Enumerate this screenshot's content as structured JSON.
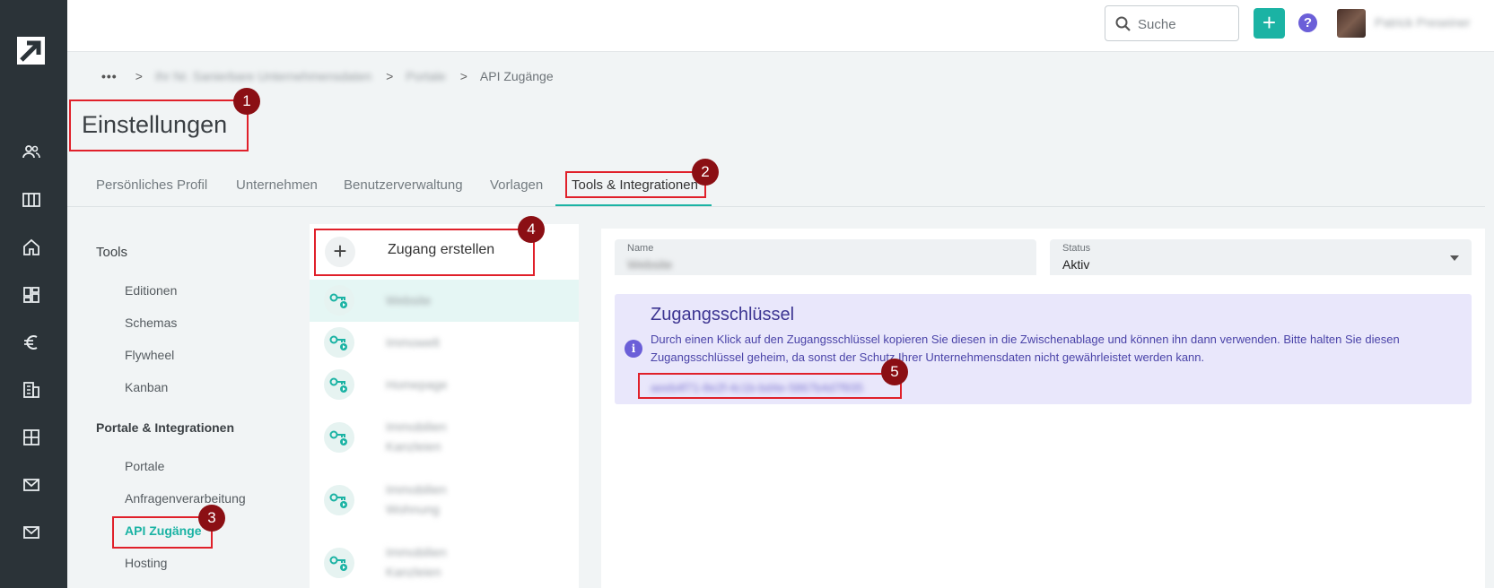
{
  "topbar": {
    "search_placeholder": "Suche",
    "add_label": "+",
    "help_label": "?",
    "user_name": "Patrick Preseiner"
  },
  "breadcrumb": {
    "dots": "•••",
    "sep": ">",
    "level1": "Ihr Nr. Sanierbare Unternehmensdaten",
    "level2": "Portale",
    "current": "API Zugänge"
  },
  "page": {
    "title": "Einstellungen"
  },
  "tabs": [
    {
      "label": "Persönliches Profil"
    },
    {
      "label": "Unternehmen"
    },
    {
      "label": "Benutzerverwaltung"
    },
    {
      "label": "Vorlagen"
    },
    {
      "label": "Tools & Integrationen",
      "active": true
    }
  ],
  "subnav": {
    "group1": "Tools",
    "items1": [
      "Editionen",
      "Schemas",
      "Flywheel",
      "Kanban"
    ],
    "group2": "Portale & Integrationen",
    "items2": [
      "Portale",
      "Anfragenverarbeitung",
      "API Zugänge",
      "Hosting"
    ]
  },
  "list": {
    "create_label": "Zugang erstellen",
    "items": [
      {
        "line1": "Website"
      },
      {
        "line1": "Immowelt"
      },
      {
        "line1": "Homepage"
      },
      {
        "line1": "Immobilien",
        "line2": "Kanzleien"
      },
      {
        "line1": "Immobilien",
        "line2": "Wohnung"
      },
      {
        "line1": "Immobilien",
        "line2": "Kanzleien"
      }
    ]
  },
  "detail": {
    "name_label": "Name",
    "name_value": "Website",
    "status_label": "Status",
    "status_value": "Aktiv",
    "info_icon": "i",
    "key_title": "Zugangsschlüssel",
    "key_text": "Durch einen Klick auf den Zugangsschlüssel kopieren Sie diesen in die Zwischenablage und können ihn dann verwenden. Bitte halten Sie diesen Zugangsschlüssel geheim, da sonst der Schutz Ihrer Unternehmensdaten nicht gewährleistet werden kann.",
    "key_value": "aeeb4f71-8e2f-4c1b-bd4e-5867b4d7f935"
  },
  "annotations": [
    "1",
    "2",
    "3",
    "4",
    "5"
  ],
  "colors": {
    "accent": "#1bb3a4",
    "rail": "#2b3338",
    "annotation": "#e0202a",
    "badge": "#8b0f14",
    "info": "#6b5fd8"
  }
}
